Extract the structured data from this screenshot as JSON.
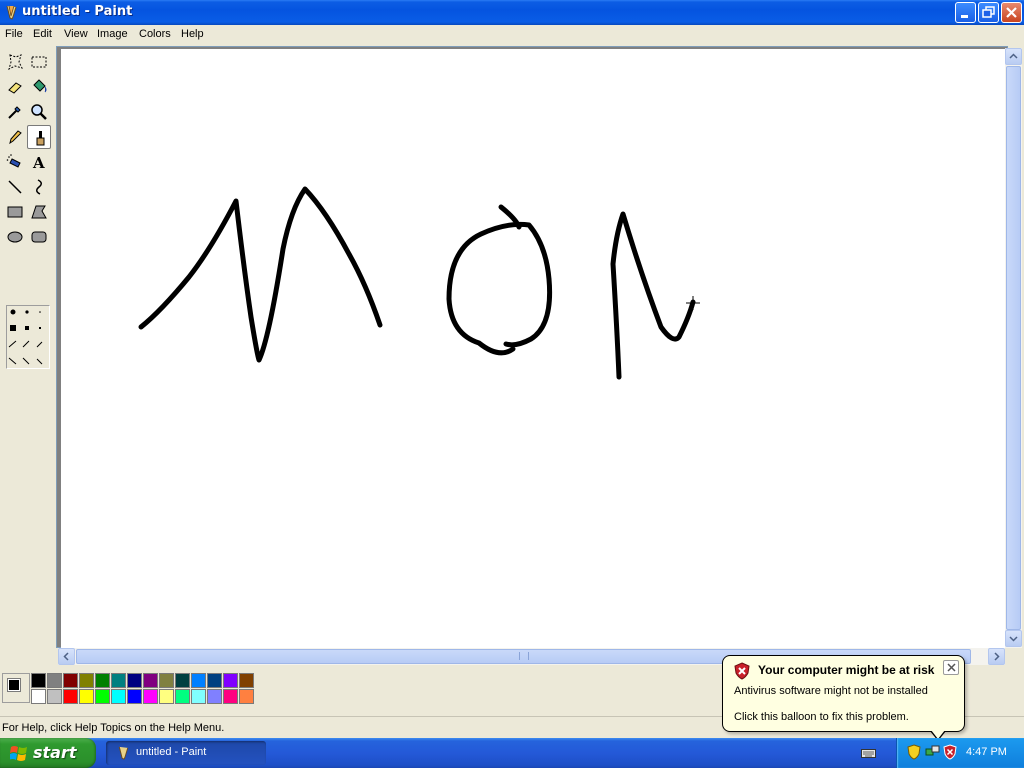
{
  "window": {
    "title": "untitled - Paint"
  },
  "menu": [
    {
      "label": "File"
    },
    {
      "label": "Edit"
    },
    {
      "label": "View"
    },
    {
      "label": "Image"
    },
    {
      "label": "Colors"
    },
    {
      "label": "Help"
    }
  ],
  "tools": [
    {
      "name": "free-form-select",
      "icon": "free-form-select-icon"
    },
    {
      "name": "rect-select",
      "icon": "rect-select-icon"
    },
    {
      "name": "eraser",
      "icon": "eraser-icon"
    },
    {
      "name": "fill",
      "icon": "fill-bucket-icon"
    },
    {
      "name": "pick-color",
      "icon": "eyedropper-icon"
    },
    {
      "name": "magnifier",
      "icon": "magnifier-icon"
    },
    {
      "name": "pencil",
      "icon": "pencil-icon"
    },
    {
      "name": "brush",
      "icon": "brush-icon",
      "selected": true
    },
    {
      "name": "airbrush",
      "icon": "airbrush-icon"
    },
    {
      "name": "text",
      "icon": "text-icon"
    },
    {
      "name": "line",
      "icon": "line-icon"
    },
    {
      "name": "curve",
      "icon": "curve-icon"
    },
    {
      "name": "rectangle",
      "icon": "rectangle-icon"
    },
    {
      "name": "polygon",
      "icon": "polygon-icon"
    },
    {
      "name": "ellipse",
      "icon": "ellipse-icon"
    },
    {
      "name": "rounded-rectangle",
      "icon": "rounded-rectangle-icon"
    }
  ],
  "palette": {
    "foreground": "#000000",
    "background": "#ffffff",
    "top_row": [
      "#000000",
      "#808080",
      "#800000",
      "#808000",
      "#008000",
      "#008080",
      "#000080",
      "#800080",
      "#808040",
      "#004040",
      "#0080ff",
      "#004080",
      "#8000ff",
      "#804000"
    ],
    "bottom_row": [
      "#ffffff",
      "#c0c0c0",
      "#ff0000",
      "#ffff00",
      "#00ff00",
      "#00ffff",
      "#0000ff",
      "#ff00ff",
      "#ffff80",
      "#00ff80",
      "#80ffff",
      "#8080ff",
      "#ff0080",
      "#ff8040"
    ]
  },
  "status": {
    "text": "For Help, click Help Topics on the Help Menu."
  },
  "balloon": {
    "title": "Your computer might be at risk",
    "line1": "Antivirus software might not be installed",
    "line2": "Click this balloon to fix this problem."
  },
  "taskbar": {
    "start_label": "start",
    "task_label": "untitled - Paint",
    "clock": "4:47 PM"
  },
  "colors": {
    "titlebar": "#0554e0",
    "taskbar": "#2459d8",
    "start": "#2f9a2f",
    "balloon": "#ffffe1"
  }
}
